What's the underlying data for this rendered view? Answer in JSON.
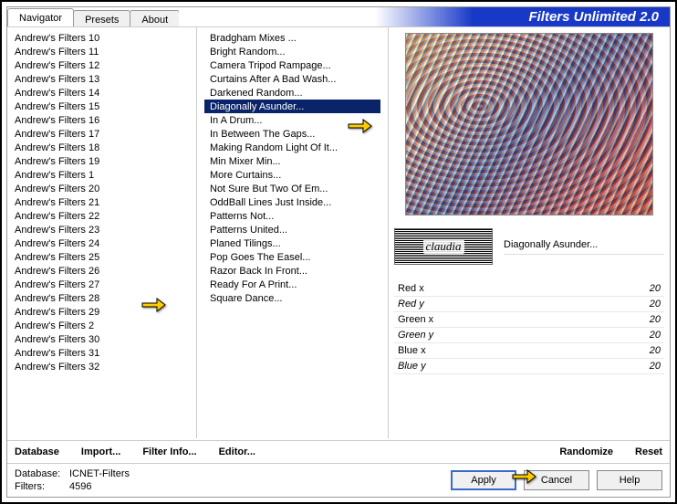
{
  "title": "Filters Unlimited 2.0",
  "tabs": [
    {
      "label": "Navigator",
      "active": true
    },
    {
      "label": "Presets",
      "active": false
    },
    {
      "label": "About",
      "active": false
    }
  ],
  "categories": [
    "Andrew's Filters 10",
    "Andrew's Filters 11",
    "Andrew's Filters 12",
    "Andrew's Filters 13",
    "Andrew's Filters 14",
    "Andrew's Filters 15",
    "Andrew's Filters 16",
    "Andrew's Filters 17",
    "Andrew's Filters 18",
    "Andrew's Filters 19",
    "Andrew's Filters 1",
    "Andrew's Filters 20",
    "Andrew's Filters 21",
    "Andrew's Filters 22",
    "Andrew's Filters 23",
    "Andrew's Filters 24",
    "Andrew's Filters 25",
    "Andrew's Filters 26",
    "Andrew's Filters 27",
    "Andrew's Filters 28",
    "Andrew's Filters 29",
    "Andrew's Filters 2",
    "Andrew's Filters 30",
    "Andrew's Filters 31",
    "Andrew's Filters 32"
  ],
  "filters": [
    {
      "label": "Bradgham Mixes ...",
      "selected": false
    },
    {
      "label": "Bright Random...",
      "selected": false
    },
    {
      "label": "Camera Tripod Rampage...",
      "selected": false
    },
    {
      "label": "Curtains After A Bad Wash...",
      "selected": false
    },
    {
      "label": "Darkened Random...",
      "selected": false
    },
    {
      "label": "Diagonally Asunder...",
      "selected": true
    },
    {
      "label": "In A Drum...",
      "selected": false
    },
    {
      "label": "In Between The Gaps...",
      "selected": false
    },
    {
      "label": "Making Random Light Of It...",
      "selected": false
    },
    {
      "label": "Min Mixer Min...",
      "selected": false
    },
    {
      "label": "More Curtains...",
      "selected": false
    },
    {
      "label": "Not Sure But Two Of Em...",
      "selected": false
    },
    {
      "label": "OddBall Lines Just Inside...",
      "selected": false
    },
    {
      "label": "Patterns Not...",
      "selected": false
    },
    {
      "label": "Patterns United...",
      "selected": false
    },
    {
      "label": "Planed Tilings...",
      "selected": false
    },
    {
      "label": "Pop Goes The Easel...",
      "selected": false
    },
    {
      "label": "Razor Back In Front...",
      "selected": false
    },
    {
      "label": "Ready For A Print...",
      "selected": false
    },
    {
      "label": "Square Dance...",
      "selected": false
    }
  ],
  "logo_text": "claudia",
  "current_filter": "Diagonally Asunder...",
  "params": [
    {
      "name": "Red x",
      "value": "20"
    },
    {
      "name": "Red y",
      "value": "20",
      "ital": true
    },
    {
      "name": "Green x",
      "value": "20"
    },
    {
      "name": "Green y",
      "value": "20",
      "ital": true
    },
    {
      "name": "Blue x",
      "value": "20"
    },
    {
      "name": "Blue y",
      "value": "20",
      "ital": true
    }
  ],
  "toolbar": {
    "database": "Database",
    "import": "Import...",
    "filter_info": "Filter Info...",
    "editor": "Editor...",
    "randomize": "Randomize",
    "reset": "Reset"
  },
  "footer": {
    "db_label": "Database:",
    "db_value": "ICNET-Filters",
    "filters_label": "Filters:",
    "filters_value": "4596",
    "apply": "Apply",
    "cancel": "Cancel",
    "help": "Help"
  }
}
